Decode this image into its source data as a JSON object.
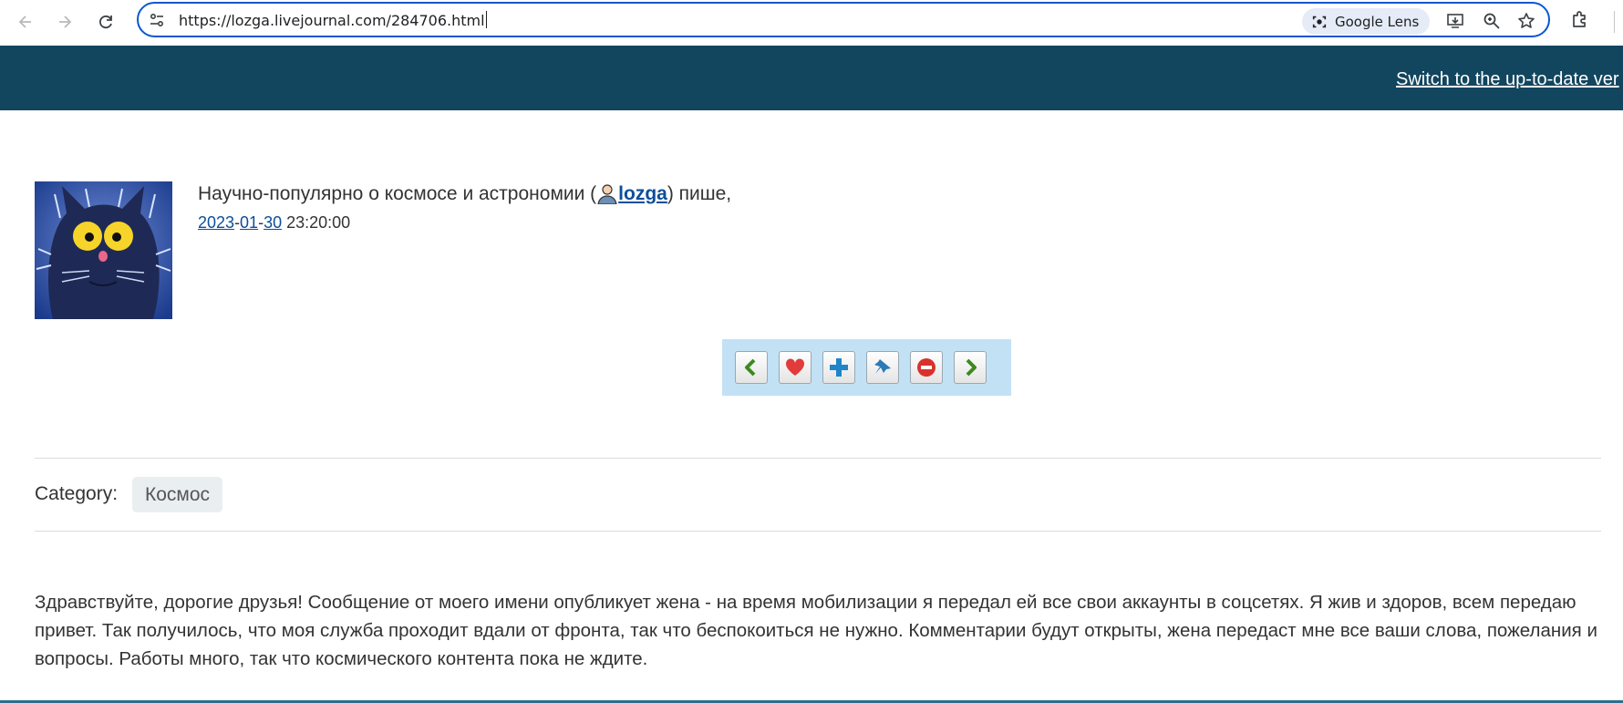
{
  "browser": {
    "url": "https://lozga.livejournal.com/284706.html",
    "lens_label": "Google Lens"
  },
  "banner": {
    "link_text": "Switch to the up-to-date ver"
  },
  "entry": {
    "journal_title": "Научно-популярно о космосе и астрономии (",
    "username": "lozga",
    "wrote": ") пише,",
    "date": {
      "year": "2023",
      "month": "01",
      "day": "30",
      "time": "23:20:00"
    },
    "toolbar": [
      "previous-icon",
      "heart-icon",
      "plus-icon",
      "pin-icon",
      "stop-icon",
      "next-icon"
    ],
    "category_label": "Category:",
    "category_tag": "Космос",
    "text": "Здравствуйте, дорогие друзья! Сообщение от моего имени опубликует жена - на время мобилизации я передал ей все свои аккаунты в соцсетях. Я жив и здоров, всем передаю привет. Так получилось, что моя служба проходит вдали от фронта, так что беспокоиться не нужно. Комментарии будут открыты, жена передаст мне все ваши слова, пожелания и вопросы. Работы много, так что космического контента пока не ждите."
  },
  "colors": {
    "banner": "#12455e",
    "link": "#0b4f99",
    "toolbar_bg": "#c2e1f5",
    "omnibox_border": "#0b57d0"
  }
}
